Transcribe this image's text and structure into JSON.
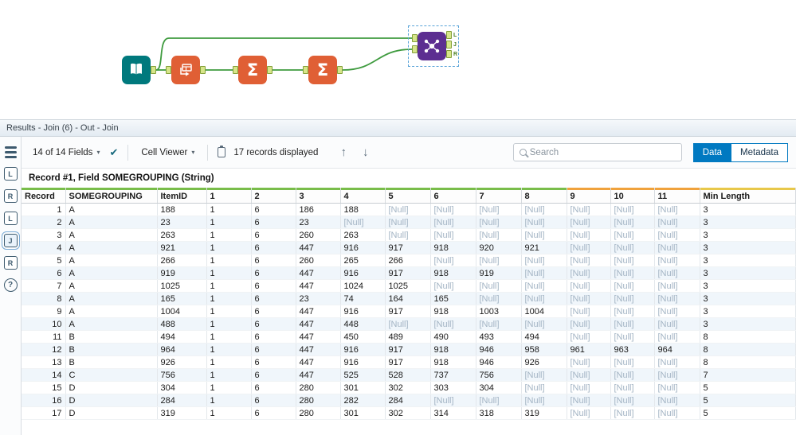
{
  "colors": {
    "accent_blue": "#0079c1",
    "connection_green": "#3f9b3f",
    "tool_orange": "#e05f35",
    "tool_teal": "#00797d",
    "tool_purple": "#5c2e91",
    "anchor_green": "#d6e58a",
    "null_text": "#a3b4c4",
    "quality_green": "#79bd4a",
    "quality_orange": "#f0a23c",
    "quality_yellow": "#e8c84a"
  },
  "canvas": {
    "summarize_glyph": "Σ",
    "join_output_anchor_labels": [
      "L",
      "J",
      "R"
    ]
  },
  "results": {
    "title": "Results - Join (6) - Out - Join",
    "sidebar": {
      "anchor_letters": [
        "L",
        "R",
        "L",
        "J",
        "R"
      ],
      "help_label": "?"
    },
    "toolbar": {
      "fields_dropdown_label": "14 of 14 Fields",
      "caret_icon": "▾",
      "check_icon": "✔",
      "cell_viewer_label": "Cell Viewer",
      "records_displayed": "17 records displayed",
      "up_arrow": "↑",
      "down_arrow": "↓",
      "search_placeholder": "Search",
      "data_tab": "Data",
      "metadata_tab": "Metadata"
    },
    "status": "Record #1, Field SOMEGROUPING (String)",
    "table": {
      "columns": [
        {
          "label": "Record",
          "bar": "green"
        },
        {
          "label": "SOMEGROUPING",
          "bar": "green"
        },
        {
          "label": "ItemID",
          "bar": "green"
        },
        {
          "label": "1",
          "bar": "green"
        },
        {
          "label": "2",
          "bar": "green"
        },
        {
          "label": "3",
          "bar": "green"
        },
        {
          "label": "4",
          "bar": "green"
        },
        {
          "label": "5",
          "bar": "green"
        },
        {
          "label": "6",
          "bar": "green"
        },
        {
          "label": "7",
          "bar": "green"
        },
        {
          "label": "8",
          "bar": "green"
        },
        {
          "label": "9",
          "bar": "orange"
        },
        {
          "label": "10",
          "bar": "orange"
        },
        {
          "label": "11",
          "bar": "orange"
        },
        {
          "label": "Min Length",
          "bar": "yellow"
        }
      ],
      "rows": [
        [
          "1",
          "A",
          "188",
          "1",
          "6",
          "186",
          "188",
          "[Null]",
          "[Null]",
          "[Null]",
          "[Null]",
          "[Null]",
          "[Null]",
          "[Null]",
          "3"
        ],
        [
          "2",
          "A",
          "23",
          "1",
          "6",
          "23",
          "[Null]",
          "[Null]",
          "[Null]",
          "[Null]",
          "[Null]",
          "[Null]",
          "[Null]",
          "[Null]",
          "3"
        ],
        [
          "3",
          "A",
          "263",
          "1",
          "6",
          "260",
          "263",
          "[Null]",
          "[Null]",
          "[Null]",
          "[Null]",
          "[Null]",
          "[Null]",
          "[Null]",
          "3"
        ],
        [
          "4",
          "A",
          "921",
          "1",
          "6",
          "447",
          "916",
          "917",
          "918",
          "920",
          "921",
          "[Null]",
          "[Null]",
          "[Null]",
          "3"
        ],
        [
          "5",
          "A",
          "266",
          "1",
          "6",
          "260",
          "265",
          "266",
          "[Null]",
          "[Null]",
          "[Null]",
          "[Null]",
          "[Null]",
          "[Null]",
          "3"
        ],
        [
          "6",
          "A",
          "919",
          "1",
          "6",
          "447",
          "916",
          "917",
          "918",
          "919",
          "[Null]",
          "[Null]",
          "[Null]",
          "[Null]",
          "3"
        ],
        [
          "7",
          "A",
          "1025",
          "1",
          "6",
          "447",
          "1024",
          "1025",
          "[Null]",
          "[Null]",
          "[Null]",
          "[Null]",
          "[Null]",
          "[Null]",
          "3"
        ],
        [
          "8",
          "A",
          "165",
          "1",
          "6",
          "23",
          "74",
          "164",
          "165",
          "[Null]",
          "[Null]",
          "[Null]",
          "[Null]",
          "[Null]",
          "3"
        ],
        [
          "9",
          "A",
          "1004",
          "1",
          "6",
          "447",
          "916",
          "917",
          "918",
          "1003",
          "1004",
          "[Null]",
          "[Null]",
          "[Null]",
          "3"
        ],
        [
          "10",
          "A",
          "488",
          "1",
          "6",
          "447",
          "448",
          "[Null]",
          "[Null]",
          "[Null]",
          "[Null]",
          "[Null]",
          "[Null]",
          "[Null]",
          "3"
        ],
        [
          "11",
          "B",
          "494",
          "1",
          "6",
          "447",
          "450",
          "489",
          "490",
          "493",
          "494",
          "[Null]",
          "[Null]",
          "[Null]",
          "8"
        ],
        [
          "12",
          "B",
          "964",
          "1",
          "6",
          "447",
          "916",
          "917",
          "918",
          "946",
          "958",
          "961",
          "963",
          "964",
          "8"
        ],
        [
          "13",
          "B",
          "926",
          "1",
          "6",
          "447",
          "916",
          "917",
          "918",
          "946",
          "926",
          "[Null]",
          "[Null]",
          "[Null]",
          "8"
        ],
        [
          "14",
          "C",
          "756",
          "1",
          "6",
          "447",
          "525",
          "528",
          "737",
          "756",
          "[Null]",
          "[Null]",
          "[Null]",
          "[Null]",
          "7"
        ],
        [
          "15",
          "D",
          "304",
          "1",
          "6",
          "280",
          "301",
          "302",
          "303",
          "304",
          "[Null]",
          "[Null]",
          "[Null]",
          "[Null]",
          "5"
        ],
        [
          "16",
          "D",
          "284",
          "1",
          "6",
          "280",
          "282",
          "284",
          "[Null]",
          "[Null]",
          "[Null]",
          "[Null]",
          "[Null]",
          "[Null]",
          "5"
        ],
        [
          "17",
          "D",
          "319",
          "1",
          "6",
          "280",
          "301",
          "302",
          "314",
          "318",
          "319",
          "[Null]",
          "[Null]",
          "[Null]",
          "5"
        ]
      ]
    }
  }
}
